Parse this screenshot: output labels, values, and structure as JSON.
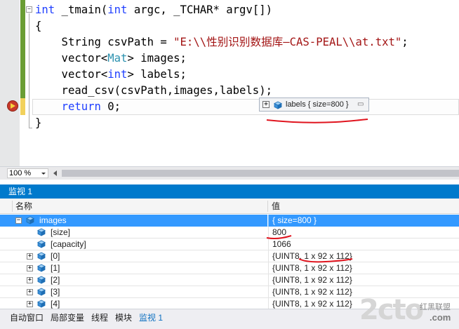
{
  "editor": {
    "lines": [
      {
        "id": "sig",
        "tokens": [
          {
            "t": "int",
            "c": "kw"
          },
          {
            "t": " _tmain(",
            "c": ""
          },
          {
            "t": "int",
            "c": "kw"
          },
          {
            "t": " argc, _TCHAR* argv[])",
            "c": ""
          }
        ]
      },
      {
        "id": "open",
        "tokens": [
          {
            "t": "{",
            "c": ""
          }
        ]
      },
      {
        "id": "csv",
        "tokens": [
          {
            "t": "    String csvPath = ",
            "c": ""
          },
          {
            "t": "\"E:\\\\性别识别数据库—CAS-PEAL\\\\at.txt\"",
            "c": "str"
          },
          {
            "t": ";",
            "c": ""
          }
        ]
      },
      {
        "id": "images",
        "tokens": [
          {
            "t": "    vector<",
            "c": ""
          },
          {
            "t": "Mat",
            "c": "type"
          },
          {
            "t": "> images;",
            "c": ""
          }
        ]
      },
      {
        "id": "labels",
        "tokens": [
          {
            "t": "    vector<",
            "c": ""
          },
          {
            "t": "int",
            "c": "kw"
          },
          {
            "t": "> labels;",
            "c": ""
          }
        ]
      },
      {
        "id": "read",
        "tokens": [
          {
            "t": "    read_csv(csvPath,images,labels);",
            "c": ""
          }
        ]
      },
      {
        "id": "ret",
        "tokens": [
          {
            "t": "    ",
            "c": ""
          },
          {
            "t": "return",
            "c": "kw"
          },
          {
            "t": " 0;",
            "c": ""
          }
        ]
      },
      {
        "id": "close",
        "tokens": [
          {
            "t": "}",
            "c": ""
          }
        ]
      }
    ],
    "collapse_symbol": "−",
    "datatip": {
      "expand": "+",
      "text": "labels { size=800 }",
      "pin": "▭"
    }
  },
  "zoom": {
    "value": "100 %"
  },
  "watch": {
    "title": "监视 1",
    "col_name": "名称",
    "col_value": "值",
    "rows": [
      {
        "name": "images",
        "value": "{ size=800 }",
        "expand": "−",
        "level": 0,
        "selected": true
      },
      {
        "name": "[size]",
        "value": "800",
        "expand": "",
        "level": 1,
        "selected": false
      },
      {
        "name": "[capacity]",
        "value": "1066",
        "expand": "",
        "level": 1,
        "selected": false
      },
      {
        "name": "[0]",
        "value": "{UINT8, 1 x 92 x 112}",
        "expand": "+",
        "level": 1,
        "selected": false
      },
      {
        "name": "[1]",
        "value": "{UINT8, 1 x 92 x 112}",
        "expand": "+",
        "level": 1,
        "selected": false
      },
      {
        "name": "[2]",
        "value": "{UINT8, 1 x 92 x 112}",
        "expand": "+",
        "level": 1,
        "selected": false
      },
      {
        "name": "[3]",
        "value": "{UINT8, 1 x 92 x 112}",
        "expand": "+",
        "level": 1,
        "selected": false
      },
      {
        "name": "[4]",
        "value": "{UINT8, 1 x 92 x 112}",
        "expand": "+",
        "level": 1,
        "selected": false
      }
    ]
  },
  "bottom_tabs": [
    {
      "label": "自动窗口",
      "active": false
    },
    {
      "label": "局部变量",
      "active": false
    },
    {
      "label": "线程",
      "active": false
    },
    {
      "label": "模块",
      "active": false
    },
    {
      "label": "监视 1",
      "active": true
    }
  ],
  "watermark": {
    "main": "2cto",
    "sub": "红黑联盟",
    "com": ".com"
  },
  "colors": {
    "accent": "#007acc",
    "selection": "#3399ff",
    "keyword": "#1f3fff",
    "string": "#a31515",
    "type": "#2b91af",
    "annotation": "#e0141e"
  }
}
